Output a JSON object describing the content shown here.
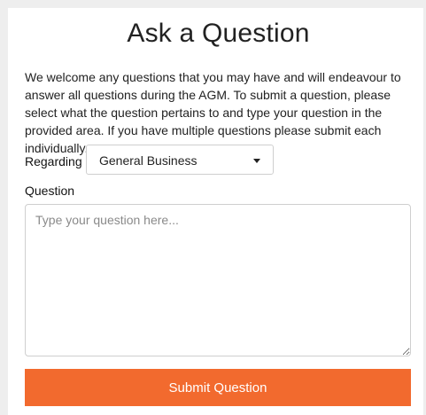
{
  "form": {
    "title": "Ask a Question",
    "intro": "We welcome any questions that you may have and will endeavour to answer all questions during the AGM. To submit a question, please select what the question pertains to and type your question in the provided area. If you have multiple questions please submit each individually.",
    "regarding_label": "Regarding",
    "regarding_selected": "General Business",
    "question_label": "Question",
    "question_placeholder": "Type your question here...",
    "question_value": "",
    "submit_label": "Submit Question"
  },
  "icons": {
    "dropdown": "chevron-down-icon"
  },
  "colors": {
    "accent": "#f26a2e",
    "border": "#cfcfcf",
    "text": "#222222",
    "placeholder": "#8a8a8a"
  }
}
